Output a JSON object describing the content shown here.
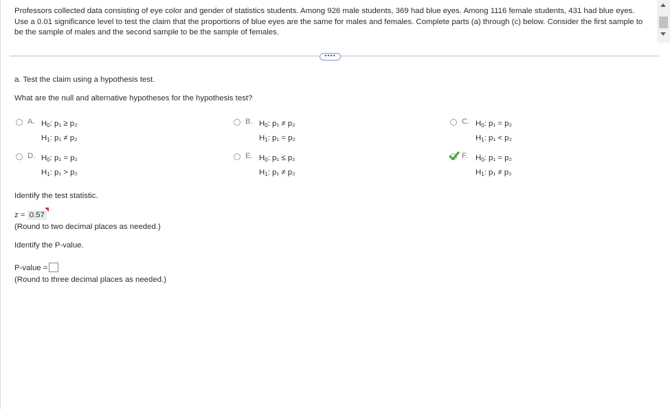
{
  "problem": {
    "text": "Professors collected data consisting of eye color and gender of statistics students. Among 926 male students, 369 had blue eyes. Among 1116 female students, 431 had blue eyes. Use a 0.01 significance level to test the claim that the proportions of blue eyes are the same for males and females. Complete parts (a) through (c) below. Consider the first sample to be the sample of males and the second sample to be the sample of females."
  },
  "more_button": "••••",
  "part_a": {
    "title": "a. Test the claim using a hypothesis test.",
    "question": "What are the null and alternative hypotheses for the hypothesis test?",
    "choices": [
      {
        "letter": "A.",
        "h0": {
          "label": "H",
          "sub": "0",
          "rel": ": p₁ ≥ p₂"
        },
        "h1": {
          "label": "H",
          "sub": "1",
          "rel": ": p₁ ≠ p₂"
        }
      },
      {
        "letter": "B.",
        "h0": {
          "label": "H",
          "sub": "0",
          "rel": ": p₁ ≠ p₂"
        },
        "h1": {
          "label": "H",
          "sub": "1",
          "rel": ": p₁ = p₂"
        }
      },
      {
        "letter": "C.",
        "h0": {
          "label": "H",
          "sub": "0",
          "rel": ": p₁ = p₂"
        },
        "h1": {
          "label": "H",
          "sub": "1",
          "rel": ": p₁ < p₂"
        }
      },
      {
        "letter": "D.",
        "h0": {
          "label": "H",
          "sub": "0",
          "rel": ": p₁ = p₂"
        },
        "h1": {
          "label": "H",
          "sub": "1",
          "rel": ": p₁ > p₂"
        }
      },
      {
        "letter": "E.",
        "h0": {
          "label": "H",
          "sub": "0",
          "rel": ": p₁ ≤ p₂"
        },
        "h1": {
          "label": "H",
          "sub": "1",
          "rel": ": p₁ ≠ p₂"
        }
      },
      {
        "letter": "F.",
        "h0": {
          "label": "H",
          "sub": "0",
          "rel": ": p₁ = p₂"
        },
        "h1": {
          "label": "H",
          "sub": "1",
          "rel": ": p₁ ≠ p₂"
        },
        "selected": true
      }
    ],
    "test_stat_prompt": "Identify the test statistic.",
    "z_label": "z =",
    "z_value": "0.57",
    "z_hint": "(Round to two decimal places as needed.)",
    "pvalue_prompt": "Identify the P-value.",
    "pvalue_label": "P-value =",
    "pvalue_value": "",
    "pvalue_hint": "(Round to three decimal places as needed.)"
  },
  "colors": {
    "check": "#3aa83a",
    "flag": "#c0392b",
    "divider": "#b8c4d4"
  }
}
